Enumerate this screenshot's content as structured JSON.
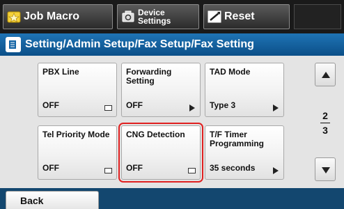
{
  "toolbar": {
    "job_macro": "Job Macro",
    "device_settings_line1": "Device",
    "device_settings_line2": "Settings",
    "reset": "Reset"
  },
  "title": "Setting/Admin Setup/Fax Setup/Fax Setting",
  "tiles": [
    {
      "label": "PBX Line",
      "value": "OFF",
      "indicator": "box"
    },
    {
      "label": "Forwarding Setting",
      "value": "OFF",
      "indicator": "arrow"
    },
    {
      "label": "TAD Mode",
      "value": "Type 3",
      "indicator": "arrow"
    },
    {
      "label": "Tel Priority Mode",
      "value": "OFF",
      "indicator": "box"
    },
    {
      "label": "CNG Detection",
      "value": "OFF",
      "indicator": "box",
      "selected": true
    },
    {
      "label": "T/F Timer Programming",
      "value": "35 seconds",
      "indicator": "arrow"
    }
  ],
  "pager": {
    "current": "2",
    "total": "3"
  },
  "back": "Back",
  "colors": {
    "title_bar": "#1565a5",
    "selection": "#e02020",
    "bottom_bar": "#13476f"
  }
}
